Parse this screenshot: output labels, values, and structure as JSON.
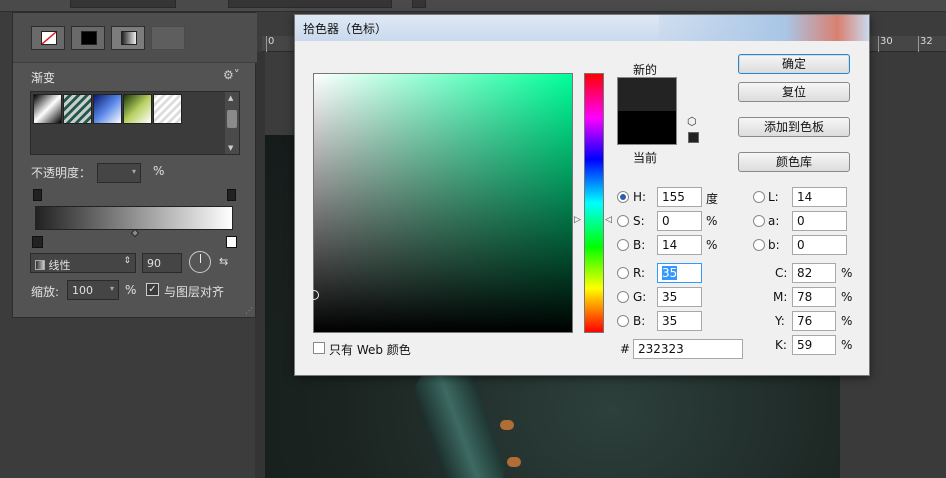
{
  "picker": {
    "title": "拾色器（色标）",
    "label_new": "新的",
    "label_current": "当前",
    "buttons": {
      "ok": "确定",
      "reset": "复位",
      "add_swatch": "添加到色板",
      "libraries": "颜色库"
    },
    "hsb": {
      "h": {
        "label": "H:",
        "value": "155",
        "unit": "度"
      },
      "s": {
        "label": "S:",
        "value": "0",
        "unit": "%"
      },
      "b": {
        "label": "B:",
        "value": "14",
        "unit": "%"
      }
    },
    "rgb": {
      "r": {
        "label": "R:",
        "value": "35"
      },
      "g": {
        "label": "G:",
        "value": "35"
      },
      "b": {
        "label": "B:",
        "value": "35"
      }
    },
    "lab": {
      "l": {
        "label": "L:",
        "value": "14"
      },
      "a": {
        "label": "a:",
        "value": "0"
      },
      "b": {
        "label": "b:",
        "value": "0"
      }
    },
    "cmyk": {
      "c": {
        "label": "C:",
        "value": "82",
        "unit": "%"
      },
      "m": {
        "label": "M:",
        "value": "78",
        "unit": "%"
      },
      "y": {
        "label": "Y:",
        "value": "76",
        "unit": "%"
      },
      "k": {
        "label": "K:",
        "value": "59",
        "unit": "%"
      }
    },
    "hex_prefix": "#",
    "hex": "232323",
    "web_only_label": "只有 Web 颜色",
    "new_color": "#232323",
    "current_color": "#000000",
    "selected_mode": "H"
  },
  "gradient_panel": {
    "title": "渐变",
    "opacity_label": "不透明度：",
    "opacity_unit": "%",
    "type_value": "线性",
    "angle": "90",
    "scale_label": "缩放:",
    "scale_value": "100",
    "scale_unit": "%",
    "align_label": "与图层对齐",
    "align_checked": true
  },
  "ruler": {
    "ticks": [
      "0",
      "30",
      "32"
    ]
  }
}
